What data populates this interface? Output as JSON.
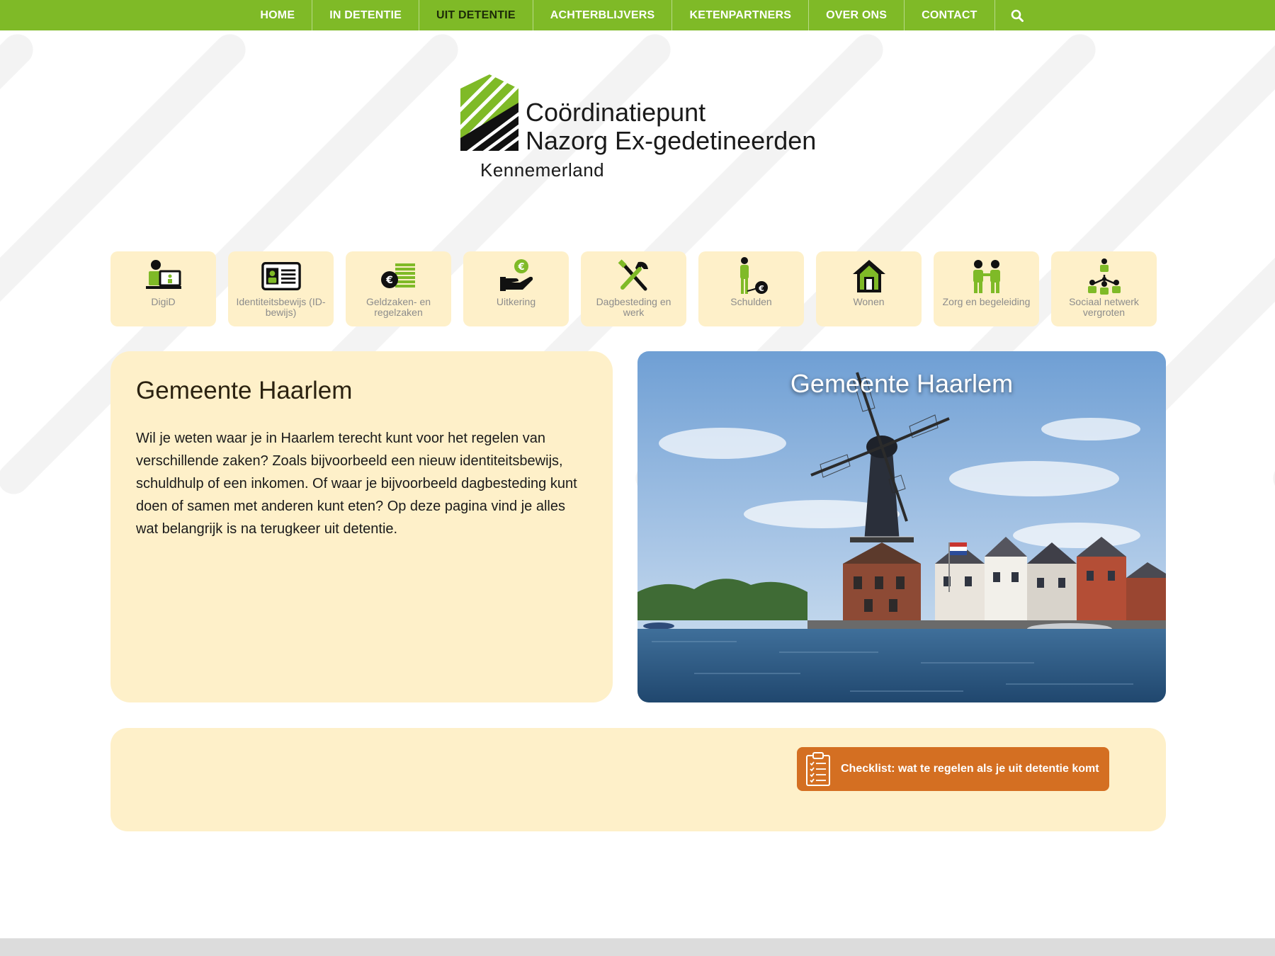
{
  "nav": {
    "items": [
      {
        "label": "HOME",
        "active": false
      },
      {
        "label": "IN DETENTIE",
        "active": false
      },
      {
        "label": "UIT DETENTIE",
        "active": true
      },
      {
        "label": "ACHTERBLIJVERS",
        "active": false
      },
      {
        "label": "KETENPARTNERS",
        "active": false
      },
      {
        "label": "OVER ONS",
        "active": false
      },
      {
        "label": "CONTACT",
        "active": false
      }
    ],
    "search_icon": "search-icon"
  },
  "logo": {
    "line1": "Coördinatiepunt",
    "line2": "Nazorg Ex-gedetineerden",
    "line3": "Kennemerland"
  },
  "tiles": [
    {
      "label": "DigiD",
      "icon": "digid-computer-icon"
    },
    {
      "label": "Identiteitsbewijs (ID-bewijs)",
      "icon": "id-card-icon"
    },
    {
      "label": "Geldzaken- en regelzaken",
      "icon": "money-stack-icon"
    },
    {
      "label": "Uitkering",
      "icon": "hand-euro-icon"
    },
    {
      "label": "Dagbesteding en werk",
      "icon": "tools-icon"
    },
    {
      "label": "Schulden",
      "icon": "person-debt-icon"
    },
    {
      "label": "Wonen",
      "icon": "house-icon"
    },
    {
      "label": "Zorg en begeleiding",
      "icon": "two-people-icon"
    },
    {
      "label": "Sociaal netwerk vergroten",
      "icon": "network-icon"
    }
  ],
  "intro": {
    "title": "Gemeente Haarlem",
    "body": "Wil je weten waar je in Haarlem terecht kunt voor het regelen van verschillende zaken? Zoals bijvoorbeeld een nieuw identiteitsbewijs, schuldhulp of een inkomen. Of waar je bijvoorbeeld dagbesteding kunt doen of samen met anderen kunt eten? Op deze pagina vind je alles wat belangrijk is na terugkeer uit detentie."
  },
  "photo": {
    "title": "Gemeente Haarlem"
  },
  "checklist": {
    "label": "Checklist: wat te regelen als je uit detentie komt",
    "icon": "clipboard-checklist-icon"
  },
  "colors": {
    "brand_green": "#7fba27",
    "tile_bg": "#fef0c9",
    "button_orange": "#d46f22"
  }
}
